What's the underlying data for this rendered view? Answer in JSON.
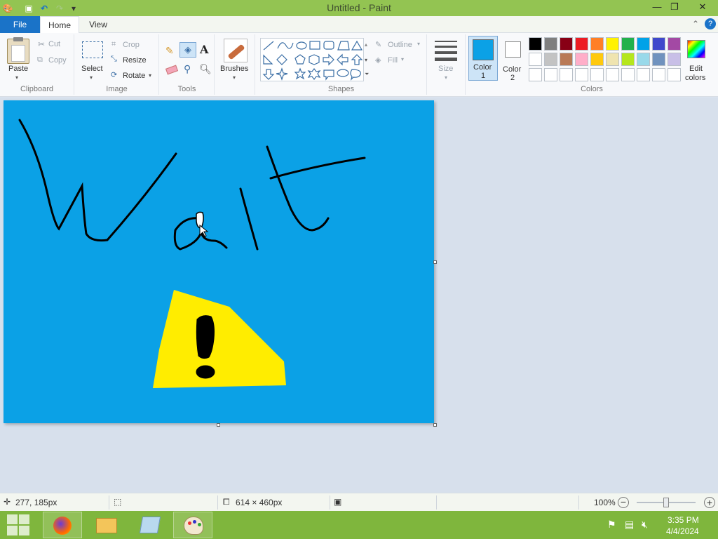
{
  "window": {
    "title": "Untitled - Paint",
    "minimize": "—",
    "restore": "❐",
    "close": "✕"
  },
  "tabs": {
    "file": "File",
    "home": "Home",
    "view": "View"
  },
  "clipboard": {
    "paste": "Paste",
    "cut": "Cut",
    "copy": "Copy",
    "label": "Clipboard"
  },
  "image": {
    "select": "Select",
    "crop": "Crop",
    "resize": "Resize",
    "rotate": "Rotate",
    "label": "Image"
  },
  "tools": {
    "label": "Tools",
    "text_glyph": "A"
  },
  "brushes": {
    "label": "Brushes"
  },
  "shapes": {
    "outline": "Outline",
    "fill": "Fill",
    "label": "Shapes"
  },
  "size": {
    "label": "Size"
  },
  "color1": {
    "label": "Color",
    "num": "1",
    "color": "#0ba1e6"
  },
  "color2": {
    "label": "Color",
    "num": "2",
    "color": "#ffffff"
  },
  "colors": {
    "label": "Colors",
    "edit_label_line1": "Edit",
    "edit_label_line2": "colors",
    "row1": [
      "#000000",
      "#7f7f7f",
      "#880015",
      "#ed1c24",
      "#ff7f27",
      "#fff200",
      "#22b14c",
      "#00a2e8",
      "#3f48cc",
      "#a349a4"
    ],
    "row2": [
      "#ffffff",
      "#c3c3c3",
      "#b97a57",
      "#ffaec9",
      "#ffc90e",
      "#efe4b0",
      "#b5e61d",
      "#99d9ea",
      "#7092be",
      "#c8bfe7"
    ],
    "row3": [
      "#ffffff",
      "#ffffff",
      "#ffffff",
      "#ffffff",
      "#ffffff",
      "#ffffff",
      "#ffffff",
      "#ffffff",
      "#ffffff",
      "#ffffff"
    ]
  },
  "drawing": {
    "background": "#0ba1e6",
    "triangle_color": "#ffed00",
    "ink_color": "#000000"
  },
  "status": {
    "cursor_pos": "277, 185px",
    "canvas_size": "614 × 460px",
    "zoom": "100%",
    "zoom_level": 0.5
  },
  "taskbar": {
    "time": "3:35 PM",
    "date": "4/4/2024"
  }
}
